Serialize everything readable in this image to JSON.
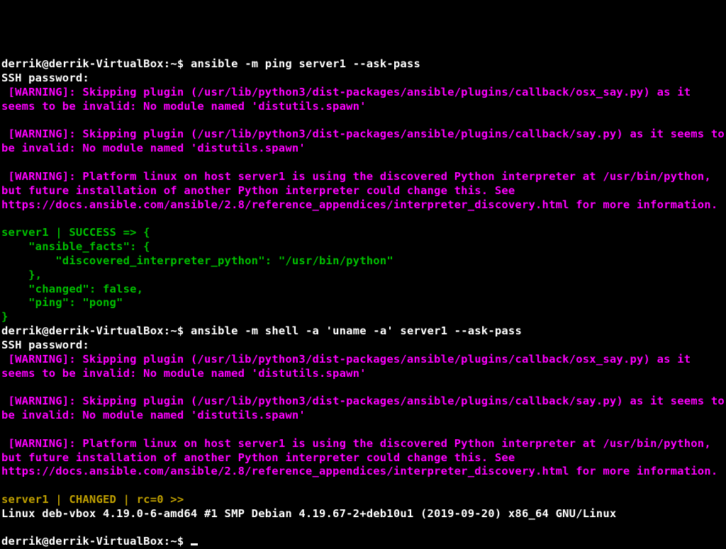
{
  "prompt1": {
    "user_host": "derrik@derrik-VirtualBox",
    "sep": ":",
    "path": "~",
    "end": "$ ",
    "command": "ansible -m ping server1 --ask-pass"
  },
  "ssh_prompt": "SSH password: ",
  "warn_osx_say": " [WARNING]: Skipping plugin (/usr/lib/python3/dist-packages/ansible/plugins/callback/osx_say.py) as it seems to be invalid: No module named 'distutils.spawn'",
  "warn_say": " [WARNING]: Skipping plugin (/usr/lib/python3/dist-packages/ansible/plugins/callback/say.py) as it seems to be invalid: No module named 'distutils.spawn'",
  "warn_interp": " [WARNING]: Platform linux on host server1 is using the discovered Python interpreter at /usr/bin/python, but future installation of another Python interpreter could change this. See https://docs.ansible.com/ansible/2.8/reference_appendices/interpreter_discovery.html for more information.",
  "success_block": "server1 | SUCCESS => {\n    \"ansible_facts\": {\n        \"discovered_interpreter_python\": \"/usr/bin/python\"\n    }, \n    \"changed\": false, \n    \"ping\": \"pong\"\n}",
  "prompt2": {
    "user_host": "derrik@derrik-VirtualBox",
    "sep": ":",
    "path": "~",
    "end": "$ ",
    "command": "ansible -m shell -a 'uname -a' server1 --ask-pass"
  },
  "changed_header": "server1 | CHANGED | rc=0 >>",
  "uname_output": "Linux deb-vbox 4.19.0-6-amd64 #1 SMP Debian 4.19.67-2+deb10u1 (2019-09-20) x86_64 GNU/Linux",
  "prompt3": {
    "user_host": "derrik@derrik-VirtualBox",
    "sep": ":",
    "path": "~",
    "end": "$ "
  }
}
